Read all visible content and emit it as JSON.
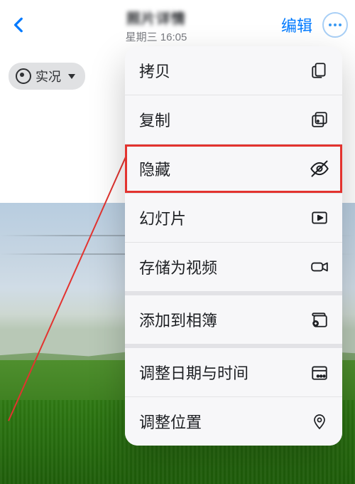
{
  "header": {
    "title_main": "照片详情",
    "title_sub": "星期三  16:05",
    "edit_label": "编辑"
  },
  "live_badge": {
    "label": "实况"
  },
  "menu": {
    "items": [
      {
        "label": "拷贝",
        "icon": "copy-doc-icon"
      },
      {
        "label": "复制",
        "icon": "duplicate-icon"
      },
      {
        "label": "隐藏",
        "icon": "eye-slash-icon",
        "highlight": true
      },
      {
        "label": "幻灯片",
        "icon": "play-rect-icon"
      },
      {
        "label": "存储为视频",
        "icon": "video-camera-icon"
      },
      {
        "label": "添加到相簿",
        "icon": "add-to-album-icon"
      },
      {
        "label": "调整日期与时间",
        "icon": "calendar-icon"
      },
      {
        "label": "调整位置",
        "icon": "location-pin-icon"
      }
    ]
  }
}
